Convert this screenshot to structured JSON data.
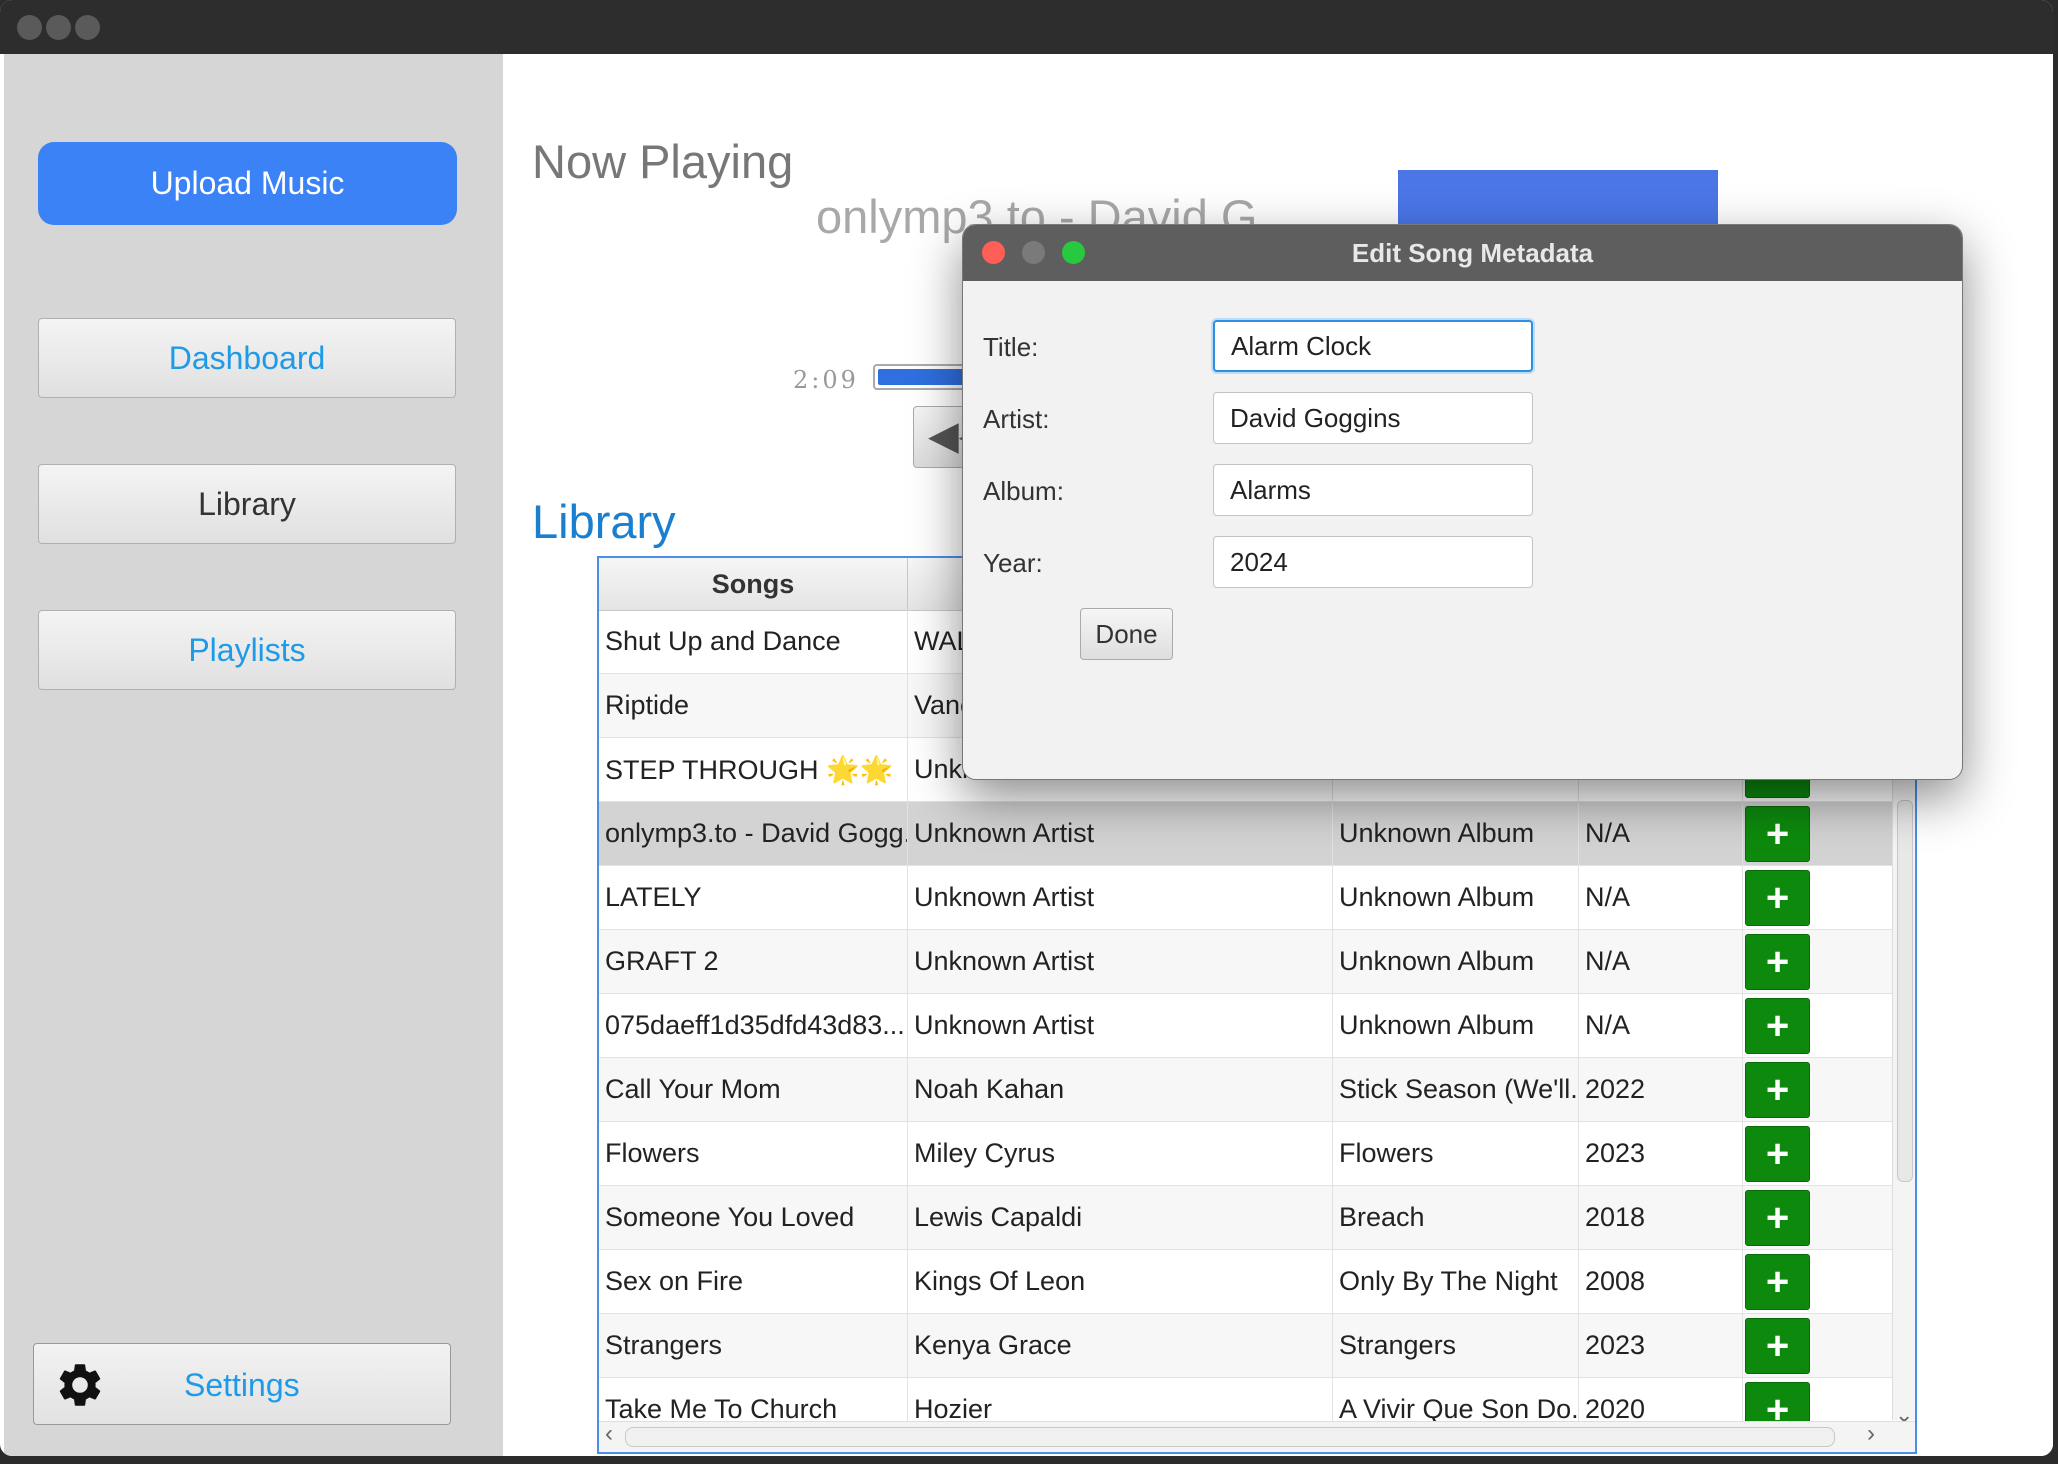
{
  "sidebar": {
    "upload_label": "Upload Music",
    "dashboard_label": "Dashboard",
    "library_label": "Library",
    "playlists_label": "Playlists",
    "settings_label": "Settings"
  },
  "now_playing": {
    "heading": "Now Playing",
    "song_title": "onlymp3.to - David G",
    "elapsed_time": "2:09"
  },
  "library": {
    "heading": "Library",
    "columns": [
      "Songs",
      "",
      "",
      "",
      ""
    ],
    "add_label": "+",
    "rows": [
      {
        "song": "Shut Up and Dance",
        "artist": "WAL",
        "album": "",
        "year": ""
      },
      {
        "song": "Riptide",
        "artist": "Vanc",
        "album": "",
        "year": ""
      },
      {
        "song": "STEP THROUGH 🌟🌟",
        "artist": "Unkn",
        "album": "",
        "year": ""
      },
      {
        "song": "onlymp3.to - David Gogg...",
        "artist": "Unknown Artist",
        "album": "Unknown Album",
        "year": "N/A"
      },
      {
        "song": "LATELY",
        "artist": "Unknown Artist",
        "album": "Unknown Album",
        "year": "N/A"
      },
      {
        "song": "GRAFT 2",
        "artist": "Unknown Artist",
        "album": "Unknown Album",
        "year": "N/A"
      },
      {
        "song": "075daeff1d35dfd43d83...",
        "artist": "Unknown Artist",
        "album": "Unknown Album",
        "year": "N/A"
      },
      {
        "song": "Call Your Mom",
        "artist": "Noah Kahan",
        "album": "Stick Season (We'll...",
        "year": "2022"
      },
      {
        "song": "Flowers",
        "artist": "Miley Cyrus",
        "album": "Flowers",
        "year": "2023"
      },
      {
        "song": "Someone You Loved",
        "artist": "Lewis Capaldi",
        "album": "Breach",
        "year": "2018"
      },
      {
        "song": "Sex on Fire",
        "artist": "Kings Of Leon",
        "album": "Only By The Night",
        "year": "2008"
      },
      {
        "song": "Strangers",
        "artist": "Kenya Grace",
        "album": "Strangers",
        "year": "2023"
      },
      {
        "song": "Take Me To Church",
        "artist": "Hozier",
        "album": "A Vivir Que Son Do...",
        "year": "2020"
      }
    ]
  },
  "dialog": {
    "title": "Edit Song Metadata",
    "title_label": "Title:",
    "title_value": "Alarm Clock",
    "artist_label": "Artist:",
    "artist_value": "David Goggins",
    "album_label": "Album:",
    "album_value": "Alarms",
    "year_label": "Year:",
    "year_value": "2024",
    "done_label": "Done"
  },
  "colors": {
    "accent_blue": "#3b82f6",
    "link_blue": "#1e9be8",
    "add_green": "#0d8a0d",
    "close_red": "#ff5f57",
    "zoom_green": "#28c840"
  }
}
